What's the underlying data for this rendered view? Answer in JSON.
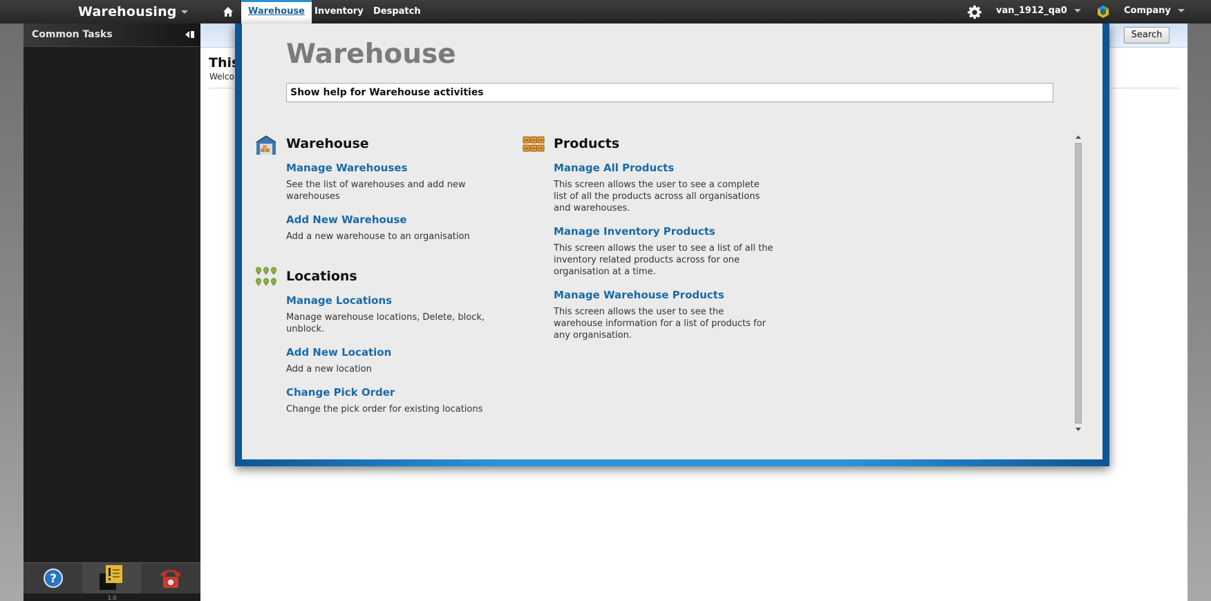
{
  "topbar": {
    "app_title": "Warehousing",
    "home_icon": "home-icon",
    "tabs": [
      {
        "label": "Warehouse",
        "active": true
      },
      {
        "label": "Inventory",
        "active": false
      },
      {
        "label": "Despatch",
        "active": false
      }
    ],
    "settings_icon": "gear-icon",
    "user": "van_1912_qa0",
    "company_icon": "company-logo",
    "company_label": "Company"
  },
  "sidebar": {
    "header": "Common Tasks",
    "collapse_icon": "collapse-icon",
    "footer_icons": [
      "help-icon",
      "note-icon",
      "phone-icon"
    ],
    "version": "1.0"
  },
  "main": {
    "search_label": "Search",
    "title": "This",
    "subtitle": "Welco"
  },
  "modal": {
    "title": "Warehouse",
    "help_text": "Show help for Warehouse activities",
    "sections": {
      "warehouse": {
        "title": "Warehouse",
        "icon": "warehouse-icon",
        "items": [
          {
            "label": "Manage Warehouses",
            "desc": "See the list of warehouses and add new warehouses"
          },
          {
            "label": "Add New Warehouse",
            "desc": "Add a new warehouse to an organisation"
          }
        ]
      },
      "locations": {
        "title": "Locations",
        "icon": "location-pins-icon",
        "items": [
          {
            "label": "Manage Locations",
            "desc": "Manage warehouse locations, Delete, block, unblock."
          },
          {
            "label": "Add New Location",
            "desc": "Add a new location"
          },
          {
            "label": "Change Pick Order",
            "desc": "Change the pick order for existing locations"
          }
        ]
      },
      "products": {
        "title": "Products",
        "icon": "products-icon",
        "items": [
          {
            "label": "Manage All Products",
            "desc": "This screen allows the user to see a complete list of all the products across all organisations and warehouses."
          },
          {
            "label": "Manage Inventory Products",
            "desc": "This screen allows the user to see a list of all the inventory related products across for one organisation at a time."
          },
          {
            "label": "Manage Warehouse Products",
            "desc": "This screen allows the user to see the warehouse information for a list of products for any organisation."
          }
        ]
      }
    }
  },
  "colors": {
    "accent": "#2b93d8",
    "link": "#1a6aa8",
    "topbar": "#2e2e2e",
    "sidebar": "#1d1d1d"
  }
}
